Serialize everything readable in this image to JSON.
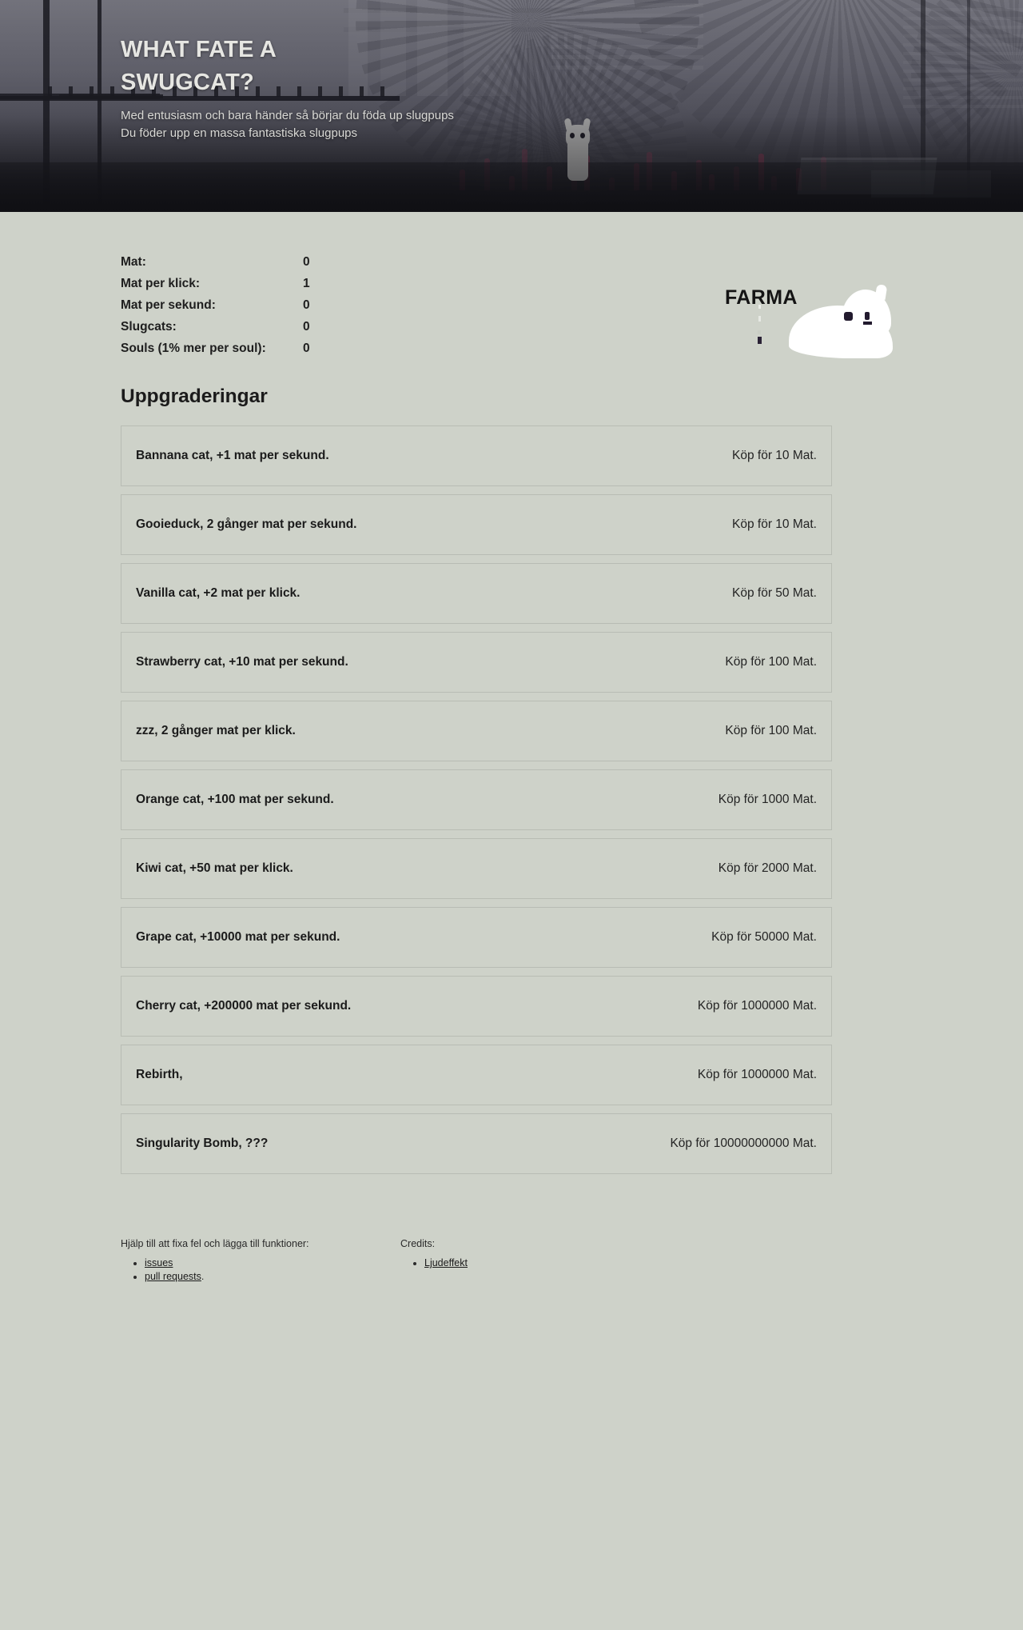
{
  "hero": {
    "title": "WHAT FATE A SWUGCAT?",
    "subtitle_line1": "Med entusiasm och bara händer så börjar du föda up slugpups",
    "subtitle_line2": "Du föder upp en massa fantastiska slugpups"
  },
  "stats": [
    {
      "label": "Mat:",
      "value": "0"
    },
    {
      "label": "Mat per klick:",
      "value": "1"
    },
    {
      "label": "Mat per sekund:",
      "value": "0"
    },
    {
      "label": "Slugcats:",
      "value": "0"
    },
    {
      "label": "Souls (1% mer per soul):",
      "value": "0"
    }
  ],
  "farm_button": {
    "label": "FARMA"
  },
  "upgrades_section": {
    "title": "Uppgraderingar"
  },
  "upgrades": [
    {
      "name": "Bannana cat, +1 mat per sekund.",
      "price": "Köp för 10 Mat."
    },
    {
      "name": "Gooieduck, 2 gånger mat per sekund.",
      "price": "Köp för 10 Mat."
    },
    {
      "name": "Vanilla cat, +2 mat per klick.",
      "price": "Köp för 50 Mat."
    },
    {
      "name": "Strawberry cat, +10 mat per sekund.",
      "price": "Köp för 100 Mat."
    },
    {
      "name": "zzz, 2 gånger mat per klick.",
      "price": "Köp för 100 Mat."
    },
    {
      "name": "Orange cat, +100 mat per sekund.",
      "price": "Köp för 1000 Mat."
    },
    {
      "name": "Kiwi cat, +50 mat per klick.",
      "price": "Köp för 2000 Mat."
    },
    {
      "name": "Grape cat, +10000 mat per sekund.",
      "price": "Köp för 50000 Mat."
    },
    {
      "name": "Cherry cat, +200000 mat per sekund.",
      "price": "Köp för 1000000 Mat."
    },
    {
      "name": "Rebirth,",
      "price": "Köp för 1000000 Mat."
    },
    {
      "name": "Singularity Bomb, ???",
      "price": "Köp för 10000000000 Mat."
    }
  ],
  "footer": {
    "left_heading": "Hjälp till att fixa fel och lägga till funktioner:",
    "left_links": [
      {
        "text": "issues",
        "suffix": ""
      },
      {
        "text": "pull requests",
        "suffix": "."
      }
    ],
    "right_heading": "Credits:",
    "right_links": [
      {
        "text": "Ljudeffekt",
        "suffix": ""
      }
    ]
  },
  "colors": {
    "page_background": "#ced2c9",
    "card_border": "#b8bcb4",
    "text": "#1b1b1b",
    "hero_title": "#e6e6e2",
    "plant_accent": "#b33a5e"
  }
}
